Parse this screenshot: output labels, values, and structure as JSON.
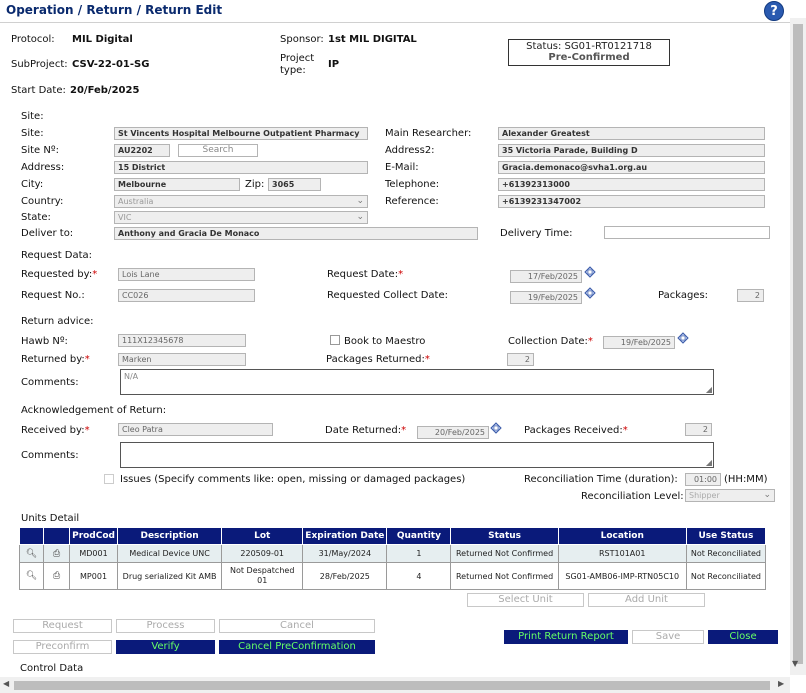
{
  "window": {
    "title": "Operation / Return / Return Edit"
  },
  "header": {
    "protocol_label": "Protocol:",
    "protocol_value": "MIL Digital",
    "sponsor_label": "Sponsor:",
    "sponsor_value": "1st MIL DIGITAL",
    "subproject_label": "SubProject:",
    "subproject_value": "CSV-22-01-SG",
    "project_type_label_1": "Project",
    "project_type_label_2": "type:",
    "project_type_value": "IP",
    "start_date_label": "Start Date:",
    "start_date_value": "20/Feb/2025",
    "status_line": "Status: SG01-RT0121718",
    "status_sub": "Pre-Confirmed"
  },
  "site": {
    "section": "Site:",
    "site_label": "Site:",
    "site_value": "St Vincents Hospital Melbourne Outpatient Pharmacy",
    "site_no_label": "Site Nº:",
    "site_no_value": "AU2202",
    "search_label": "Search",
    "address_label": "Address:",
    "address_value": "15 District",
    "city_label": "City:",
    "city_value": "Melbourne",
    "zip_label": "Zip:",
    "zip_value": "3065",
    "country_label": "Country:",
    "country_value": "Australia",
    "state_label": "State:",
    "state_value": "VIC",
    "deliver_label": "Deliver to:",
    "deliver_value": "Anthony and Gracia De Monaco",
    "main_researcher_label": "Main Researcher:",
    "main_researcher_value": "Alexander Greatest",
    "address2_label": "Address2:",
    "address2_value": "35 Victoria Parade, Building D",
    "email_label": "E-Mail:",
    "email_value": "Gracia.demonaco@svha1.org.au",
    "telephone_label": "Telephone:",
    "telephone_value": "+61392313000",
    "reference_label": "Reference:",
    "reference_value": "+6139231347002",
    "delivery_time_label": "Delivery Time:",
    "delivery_time_value": ""
  },
  "request": {
    "section": "Request Data:",
    "requested_by_label": "Requested by:",
    "requested_by_value": "Lois Lane",
    "request_date_label": "Request Date:",
    "request_date_value": "17/Feb/2025",
    "request_no_label": "Request No.:",
    "request_no_value": "CC026",
    "collect_date_label": "Requested Collect Date:",
    "collect_date_value": "19/Feb/2025",
    "packages_label": "Packages:",
    "packages_value": "2"
  },
  "return_advice": {
    "section": "Return advice:",
    "hawb_label": "Hawb Nº:",
    "hawb_value": "111X12345678",
    "book_label": "Book to Maestro",
    "collection_date_label": "Collection Date:",
    "collection_date_value": "19/Feb/2025",
    "returned_by_label": "Returned by:",
    "returned_by_value": "Marken",
    "packages_returned_label": "Packages Returned:",
    "packages_returned_value": "2",
    "comments_label": "Comments:",
    "comments_value": "N/A"
  },
  "acknowledgement": {
    "section": "Acknowledgement of Return:",
    "received_by_label": "Received by:",
    "received_by_value": "Cleo Patra",
    "date_returned_label": "Date Returned:",
    "date_returned_value": "20/Feb/2025",
    "packages_received_label": "Packages Received:",
    "packages_received_value": "2",
    "comments_label": "Comments:",
    "comments_value": "",
    "issues_label": "Issues (Specify comments like: open, missing or damaged packages)",
    "recon_time_label": "Reconciliation Time (duration):",
    "recon_time_value": "01:00",
    "recon_time_unit": "(HH:MM)",
    "recon_level_label": "Reconciliation Level:",
    "recon_level_value": "Shipper"
  },
  "units": {
    "section": "Units Detail",
    "columns": [
      "ProdCod",
      "Description",
      "Lot",
      "Expiration Date",
      "Quantity",
      "Status",
      "Location",
      "Use Status"
    ],
    "rows": [
      {
        "prod": "MD001",
        "desc": "Medical Device UNC",
        "lot": "220509-01",
        "exp": "31/May/2024",
        "qty": "1",
        "status": "Returned Not Confirmed",
        "location": "RST101A01",
        "use": "Not Reconciliated"
      },
      {
        "prod": "MP001",
        "desc": "Drug serialized Kit AMB",
        "lot": "Not Despatched 01",
        "exp": "28/Feb/2025",
        "qty": "4",
        "status": "Returned Not Confirmed",
        "location": "SG01-AMB06-IMP-RTN05C10",
        "use": "Not Reconciliated"
      }
    ],
    "select_unit": "Select Unit",
    "add_unit": "Add Unit"
  },
  "buttons": {
    "request": "Request",
    "process": "Process",
    "cancel": "Cancel",
    "preconfirm": "Preconfirm",
    "verify": "Verify",
    "cancel_preconf": "Cancel PreConfirmation",
    "print": "Print Return Report",
    "save": "Save",
    "close": "Close"
  },
  "footer": {
    "control_data": "Control Data"
  },
  "colors": {
    "accent": "#0a1a7a",
    "button_text": "#66ff66",
    "title": "#0a2a6e",
    "required": "#cc0000"
  }
}
